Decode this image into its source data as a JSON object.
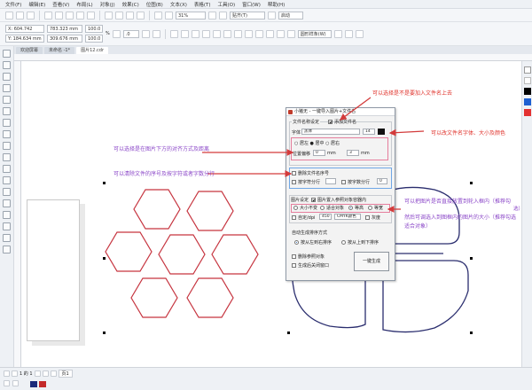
{
  "menu": [
    "文件(F)",
    "编辑(E)",
    "查看(V)",
    "布局(L)",
    "对象(J)",
    "效果(C)",
    "位图(B)",
    "文本(X)",
    "表格(T)",
    "工具(O)",
    "窗口(W)",
    "帮助(H)"
  ],
  "toolbar": {
    "zoom": "31%",
    "snap_label": "贴齐(T)",
    "launch_label": "启动"
  },
  "propbar": {
    "x": "X: 604.742 mm",
    "y": "Y: 184.634 mm",
    "w": "783.323 mm",
    "h": "309.676 mm",
    "sx": "100.0",
    "sy": "100.0",
    "pct": "%",
    "angle": ".0",
    "wrap_label": "圆形样条(W)"
  },
  "tabs": [
    "欢迎屏幕",
    "未命名 -1*",
    "图片12.cdr"
  ],
  "status": {
    "page_nav": "1 的 1",
    "page_tab": "页1"
  },
  "dialog": {
    "title": "小猪无 - 一键导入图片+文件名",
    "filename_group_label": "文件名称设定",
    "add_filename_label": "添加文件名",
    "font_label": "字体",
    "font_value": "黑体",
    "size_value": "14",
    "align_label": "○ 居左  ● 居中  ○ 居右",
    "offset_label": "位置偏移",
    "offset_x": "0",
    "offset_x_unit": "mm",
    "offset_y": "3",
    "offset_y_unit": "mm",
    "clear_index_label": "删除文件名序号",
    "char_split_label": "按字符分行",
    "char_count_label": "按字数分行",
    "char_count_value": "0",
    "image_group_label": "图片设定",
    "put_into_frame_label": "图片置入参照对象容器内",
    "size_mode_label": "大小不变",
    "fit_frame_label": "适合对象",
    "fill_label": "等高",
    "equal_width_label": "等宽",
    "custom_label": "自定/dpi",
    "dpi_value": "450",
    "cmyk_label": "CMYK颜色",
    "grayscale_label": "灰度",
    "order_group_label": "自动生成排序方式",
    "order_left_right": "按从左到右排序",
    "order_top_bottom": "按从上到下排序",
    "delete_ref_label": "删除参照对象",
    "close_after_label": "生成后关闭窗口",
    "generate_button": "一键生成"
  },
  "annotations": {
    "top_right": "可以选择是不是要加入文件名上去",
    "font_right": "可以改文件名字体、大小及颜色",
    "align_left": "可以选择是在图片下方的对齐方式及距离",
    "index_left": "可以清除文件的序号及按字符或者字数分行",
    "frame_right_1": "可以把图片是否直接放置到轮入框内（推荐勾",
    "frame_right_2": "选）",
    "frame_right_3": "然后可调选入到图框内的图片的大小（推荐勾选",
    "frame_right_4": "适合对象）"
  },
  "colors": {
    "hexagon_stroke": "#c6343f",
    "frame_stroke": "#2a2d6e",
    "annotation_red": "#e0322b",
    "annotation_purple": "#8b47c8",
    "arrow": "#d33b3b"
  }
}
